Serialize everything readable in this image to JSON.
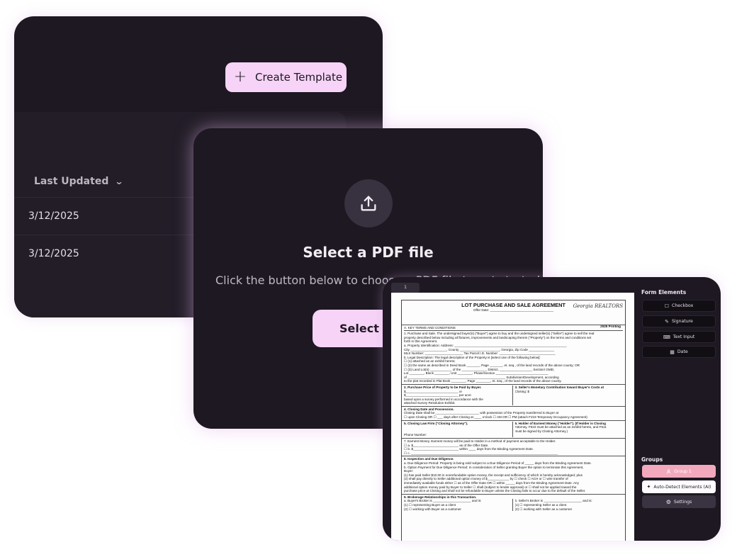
{
  "templates_card": {
    "create_template_label": "Create Template",
    "column_header": "Last Updated",
    "rows": [
      "3/12/2025",
      "3/12/2025"
    ]
  },
  "upload_card": {
    "title": "Select a PDF file",
    "subtitle": "Click the button below to choose a PDF file to get started",
    "button_label": "Select PDF"
  },
  "editor_card": {
    "page_tab": "1",
    "document": {
      "title": "LOT PURCHASE AND SALE AGREEMENT",
      "offer_date": "Offer Date: ___________________________________",
      "logo": "Georgia REALTORS",
      "printing": "2025 Printing",
      "section_a": "A.  KEY TERMS AND CONDITIONS",
      "lines": [
        "1.  Purchase and Sale. The undersigned buyer(s) (\"Buyer\") agree to buy and the undersigned seller(s) (\"Seller\") agree to sell the real",
        "     property described below including all fixtures, improvements and landscaping therein (\"Property\") on the terms and conditions set",
        "     forth in this Agreement.",
        "     a. Property Identification: Address: ______________________________________________________________",
        "         City ____________________, County ______________________, Georgia, Zip Code ______________",
        "         MLS Number: _____________________ Tax Parcel I.D. Number: _______________________________",
        "     b. Legal Description: The legal description of the Property is [select one of the following below]:",
        "         ☐ (1)  attached as an exhibit hereto;",
        "         ☐ (2)  the same as described in Deed Book _______, Page _______, et. seq., of the land records of the above county; OR",
        "         ☐ (3)  Land Lot(s) ____________ of the ______________ District, __________________ Section/ GMD,",
        "                 Lot ________, Block ________, Unit ________, Phase/Section _____________________________",
        "                 of ______________________________________________________ Subdivision/Development, according",
        "                 to the plat recorded in Plat Book ________, Page ________, et. seq., of the land records of the above county."
      ],
      "price_left": [
        "2.  Purchase Price of Property to be Paid by Buyer.",
        "     $_____________________________ or",
        "     $_____________________________ per acre",
        "     based upon a survey performed in accordance with the",
        "     attached Survey Resolution Exhibit."
      ],
      "price_right": [
        "3.   Seller's Monetary Contribution toward Buyer's Costs at",
        "      Closing: $"
      ],
      "closing": [
        "4.  Closing Date and Possession.",
        "     Closing Date shall be ________________________ with possession of the Property transferred to Buyer at",
        "     ☐ upon Closing OR ☐ ___ days after Closing at ____ o'clock ☐ AM OR ☐ PM (attach F219 Temporary Occupancy Agreement)"
      ],
      "attorney_left": [
        "5.  Closing Law Firm (\"Closing Attorney\").",
        "",
        "",
        "     Phone Number:"
      ],
      "attorney_right": [
        "6.  Holder of Earnest Money (\"Holder\"). (If Holder is Closing",
        "     Attorney, F510 must be attached as an exhibit hereto, and F511",
        "     must be signed by Closing Attorney.)"
      ],
      "earnest": [
        "7.  Earnest Money. Earnest money will be paid to Holder in a method of payment acceptable to the Holder.",
        "     ☐ a. $_________________________ as of the Offer Date.",
        "     ☐ b. $_________________________ within ____ days from the Binding Agreement Date.",
        "     ☐ c. _________________________________________________________________________________"
      ],
      "inspection": [
        "8.  Inspection and Due Diligence.",
        "     a. Due Diligence Period: Property is being sold subject to a Due Diligence Period of _____ days from the Binding Agreement Date.",
        "     b. Option Payment for Due Diligence Period: In consideration of Seller granting Buyer the option to terminate this Agreement,",
        "         Buyer:",
        "         (1)  has paid Seller $10.00 in nonrefundable option money, the receipt and sufficiency of which is hereby acknowledged; plus",
        "         (2)  shall pay directly to Seller additional option money of $____________ by ☐ check ☐ ACH or ☐ wire transfer of",
        "               immediately available funds either ☐ as of the Offer Date OR ☐ within _____ days from the Binding Agreement Date. Any",
        "               additional option money paid by Buyer to Seller ☐ shall (subject to lender approval) or ☐ shall not be applied toward the",
        "               purchase price at Closing and shall not be refundable to Buyer unless the Closing fails to occur due to the default of the Seller."
      ],
      "brokerage": "9.  Brokerage Relationships in this Transaction.",
      "broker_left": [
        "     a. Buyer's Broker is _____________________ and is:",
        "         (1) ☐ representing Buyer as a client",
        "         (2) ☐ working with Buyer as a customer"
      ],
      "broker_right": [
        "b.  Seller's Broker is _____________________ and is:",
        "     (1) ☐ representing Seller as a client",
        "     (2) ☐ working with Seller as a customer"
      ]
    },
    "panel": {
      "form_elements_heading": "Form Elements",
      "elements": [
        {
          "label": "Checkbox",
          "icon": "checkbox-icon",
          "glyph": "☐"
        },
        {
          "label": "Signature",
          "icon": "pen-icon",
          "glyph": "✎"
        },
        {
          "label": "Text Input",
          "icon": "text-input-icon",
          "glyph": "⌨"
        },
        {
          "label": "Date",
          "icon": "calendar-icon",
          "glyph": "▦"
        }
      ],
      "groups_heading": "Groups",
      "group_1": "Group 1",
      "auto_detect": "Auto-Detect Elements (AI)",
      "settings": "Settings"
    }
  },
  "colors": {
    "card_bg": "#1d1821",
    "accent_pink": "#f6d3f7",
    "group_pink": "#f3a9bd"
  }
}
